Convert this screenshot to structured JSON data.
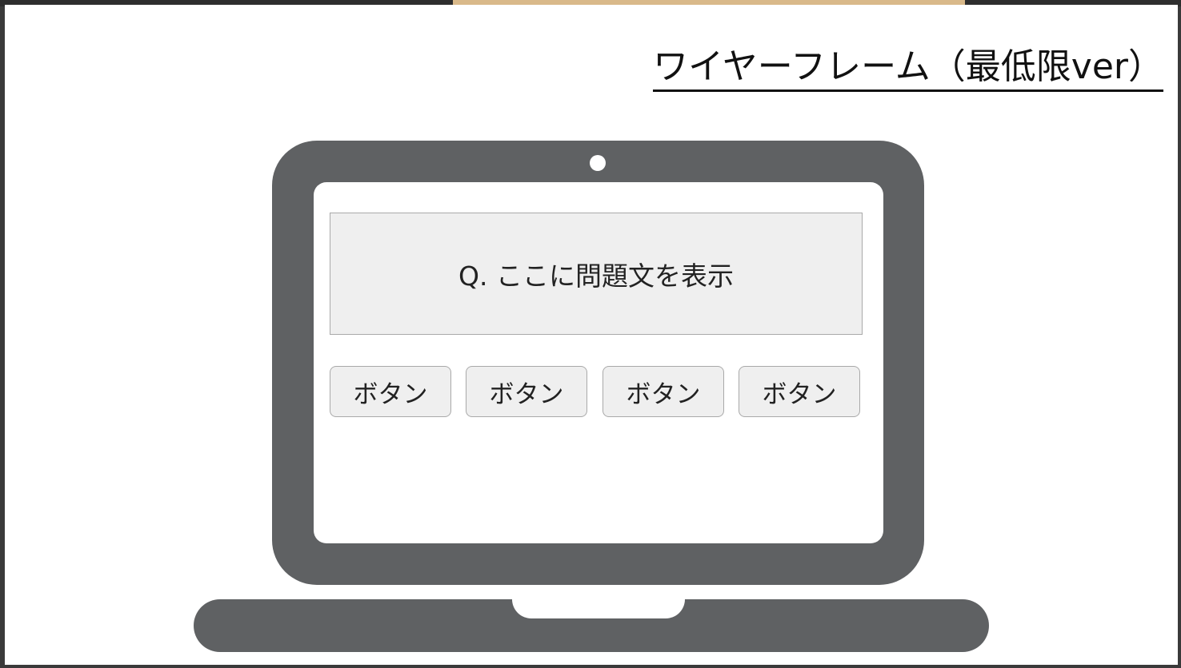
{
  "slide": {
    "title": "ワイヤーフレーム（最低限ver）"
  },
  "wireframe": {
    "question": "Q. ここに問題文を表示",
    "buttons": [
      "ボタン",
      "ボタン",
      "ボタン",
      "ボタン"
    ]
  },
  "colors": {
    "laptop": "#5f6163",
    "screen": "#ffffff",
    "box_fill": "#efefef",
    "box_border": "#a9a9a9"
  }
}
